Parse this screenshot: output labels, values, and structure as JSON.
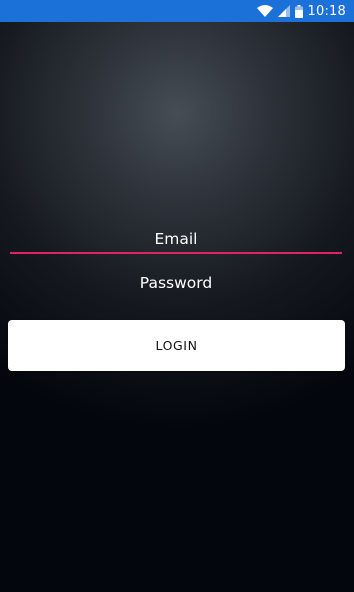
{
  "status_bar": {
    "time": "10:18",
    "icons": [
      "wifi-icon",
      "cell-signal-icon",
      "battery-icon"
    ],
    "background_color": "#1c71d8"
  },
  "form": {
    "email_placeholder": "Email",
    "password_placeholder": "Password",
    "login_label": "LOGIN",
    "email_underline_color": "#e0245e"
  }
}
